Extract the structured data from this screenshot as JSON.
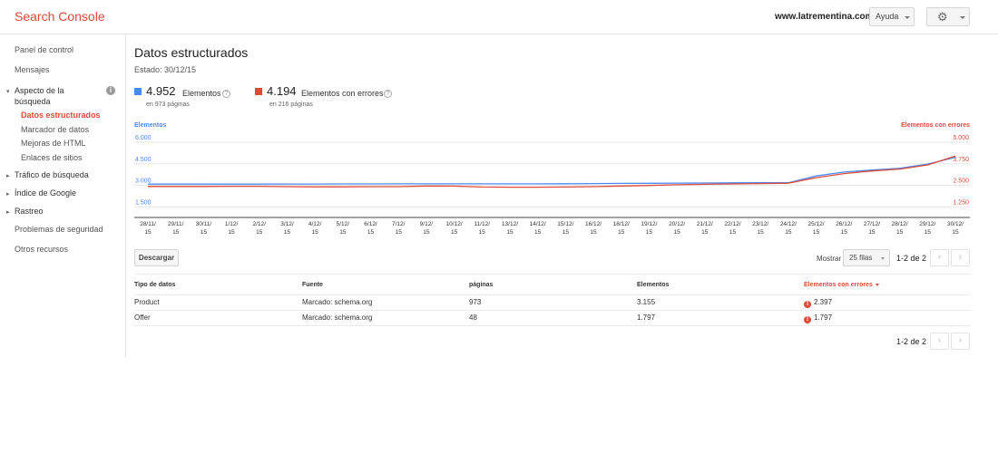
{
  "header": {
    "brand": "Search Console",
    "site": "www.latrementina.com",
    "help_label": "Ayuda"
  },
  "icons": {
    "gear": "gear-icon",
    "info": "info-icon",
    "help": "question-icon",
    "error": "error-icon",
    "prev": "chevron-left-icon",
    "next": "chevron-right-icon"
  },
  "sidebar": {
    "items": [
      {
        "label": "Panel de control"
      },
      {
        "label": "Mensajes"
      },
      {
        "label": "Aspecto de la",
        "label2": "búsqueda"
      },
      {
        "label": "Datos estructurados"
      },
      {
        "label": "Marcador de datos"
      },
      {
        "label": "Mejoras de HTML"
      },
      {
        "label": "Enlaces de sitios"
      },
      {
        "label": "Tráfico de búsqueda"
      },
      {
        "label": "Índice de Google"
      },
      {
        "label": "Rastreo"
      },
      {
        "label": "Problemas de seguridad"
      },
      {
        "label": "Otros recursos"
      }
    ]
  },
  "main": {
    "title": "Datos estructurados",
    "status": "Estado: 30/12/15",
    "stats": [
      {
        "value": "4.952",
        "label": "Elementos",
        "sub": "en 973 páginas",
        "color": "#4a8af4"
      },
      {
        "value": "4.194",
        "label": "Elementos con errores",
        "sub": "en 216 páginas",
        "color": "#dd4b39"
      }
    ]
  },
  "chart_data": {
    "type": "line",
    "left_axis_label": "Elementos",
    "right_axis_label": "Elementos con errores",
    "left_ticks": [
      "6.000",
      "4.500",
      "3.000",
      "1.500"
    ],
    "right_ticks": [
      "5.000",
      "3.750",
      "2.500",
      "1.250"
    ],
    "left_ylim": [
      0,
      6000
    ],
    "right_ylim": [
      0,
      5000
    ],
    "x": [
      "28/11/15",
      "29/11/15",
      "30/11/15",
      "1/12/15",
      "2/12/15",
      "3/12/15",
      "4/12/15",
      "5/12/15",
      "6/12/15",
      "7/12/15",
      "9/12/15",
      "10/12/15",
      "11/12/15",
      "13/12/15",
      "14/12/15",
      "15/12/15",
      "16/12/15",
      "18/12/15",
      "19/12/15",
      "20/12/15",
      "21/12/15",
      "22/12/15",
      "23/12/15",
      "24/12/15",
      "25/12/15",
      "26/12/15",
      "27/12/15",
      "28/12/15",
      "29/12/15",
      "30/12/15"
    ],
    "x_labels": [
      [
        "28/11/",
        "15"
      ],
      [
        "29/11/",
        "15"
      ],
      [
        "30/11/",
        "15"
      ],
      [
        "1/12/",
        "15"
      ],
      [
        "2/12/",
        "15"
      ],
      [
        "3/12/",
        "15"
      ],
      [
        "4/12/",
        "15"
      ],
      [
        "5/12/",
        "15"
      ],
      [
        "6/12/",
        "15"
      ],
      [
        "7/12/",
        "15"
      ],
      [
        "9/12/",
        "15"
      ],
      [
        "10/12/",
        "15"
      ],
      [
        "11/12/",
        "15"
      ],
      [
        "13/12/",
        "15"
      ],
      [
        "14/12/",
        "15"
      ],
      [
        "15/12/",
        "15"
      ],
      [
        "16/12/",
        "15"
      ],
      [
        "18/12/",
        "15"
      ],
      [
        "19/12/",
        "15"
      ],
      [
        "20/12/",
        "15"
      ],
      [
        "21/12/",
        "15"
      ],
      [
        "22/12/",
        "15"
      ],
      [
        "23/12/",
        "15"
      ],
      [
        "24/12/",
        "15"
      ],
      [
        "25/12/",
        "15"
      ],
      [
        "26/12/",
        "15"
      ],
      [
        "27/12/",
        "15"
      ],
      [
        "28/12/",
        "15"
      ],
      [
        "29/12/",
        "15"
      ],
      [
        "30/12/",
        "15"
      ]
    ],
    "series": [
      {
        "name": "Elementos",
        "axis": "left",
        "color": "#4a8af4",
        "values": [
          3080,
          3080,
          3080,
          3085,
          3085,
          3090,
          3090,
          3095,
          3095,
          3100,
          3100,
          3100,
          3100,
          3100,
          3100,
          3110,
          3120,
          3130,
          3140,
          3150,
          3160,
          3170,
          3180,
          3180,
          3650,
          3920,
          4060,
          4180,
          4480,
          4952
        ]
      },
      {
        "name": "Elementos con errores",
        "axis": "right",
        "color": "#dd4b39",
        "values": [
          2430,
          2430,
          2430,
          2440,
          2440,
          2420,
          2410,
          2410,
          2420,
          2420,
          2460,
          2450,
          2400,
          2390,
          2390,
          2400,
          2420,
          2460,
          2490,
          2530,
          2560,
          2580,
          2600,
          2620,
          2940,
          3180,
          3330,
          3440,
          3680,
          4194
        ]
      }
    ]
  },
  "toolbar": {
    "download_label": "Descargar",
    "show_label": "Mostrar",
    "rows_value": "25 filas",
    "pager": "1-2 de 2"
  },
  "table": {
    "columns": [
      "Tipo de datos",
      "Fuente",
      "páginas",
      "Elementos",
      "Elementos con errores"
    ],
    "rows": [
      [
        "Product",
        "Marcado: schema.org",
        "973",
        "3.155",
        "2.397"
      ],
      [
        "Offer",
        "Marcado: schema.org",
        "48",
        "1.797",
        "1.797"
      ]
    ]
  }
}
